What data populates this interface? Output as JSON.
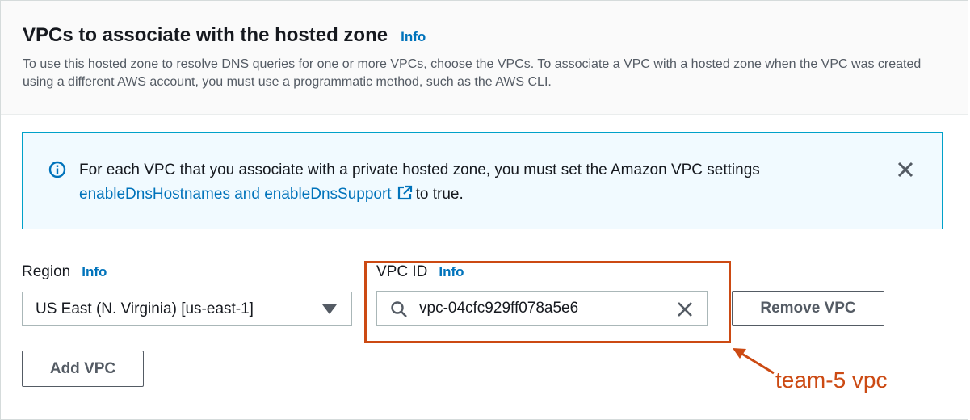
{
  "section": {
    "title": "VPCs to associate with the hosted zone",
    "info_label": "Info",
    "description": "To use this hosted zone to resolve DNS queries for one or more VPCs, choose the VPCs. To associate a VPC with a hosted zone when the VPC was created using a different AWS account, you must use a programmatic method, such as the AWS CLI."
  },
  "alert": {
    "text_before": "For each VPC that you associate with a private hosted zone, you must set the Amazon VPC settings",
    "link_text": "enableDnsHostnames and enableDnsSupport",
    "text_after": "to true.",
    "icon": "info-circle-icon",
    "close_icon": "close-icon"
  },
  "region": {
    "label": "Region",
    "info_label": "Info",
    "selected_value": "US East (N. Virginia) [us-east-1]"
  },
  "vpc_id": {
    "label": "VPC ID",
    "info_label": "Info",
    "value": "vpc-04cfc929ff078a5e6"
  },
  "buttons": {
    "remove_vpc": "Remove VPC",
    "add_vpc": "Add VPC"
  },
  "annotation": {
    "text": "team-5 vpc",
    "color": "#cc4a13"
  },
  "colors": {
    "link": "#0073bb",
    "alert_border": "#00a1c9",
    "alert_bg": "#f1faff"
  }
}
